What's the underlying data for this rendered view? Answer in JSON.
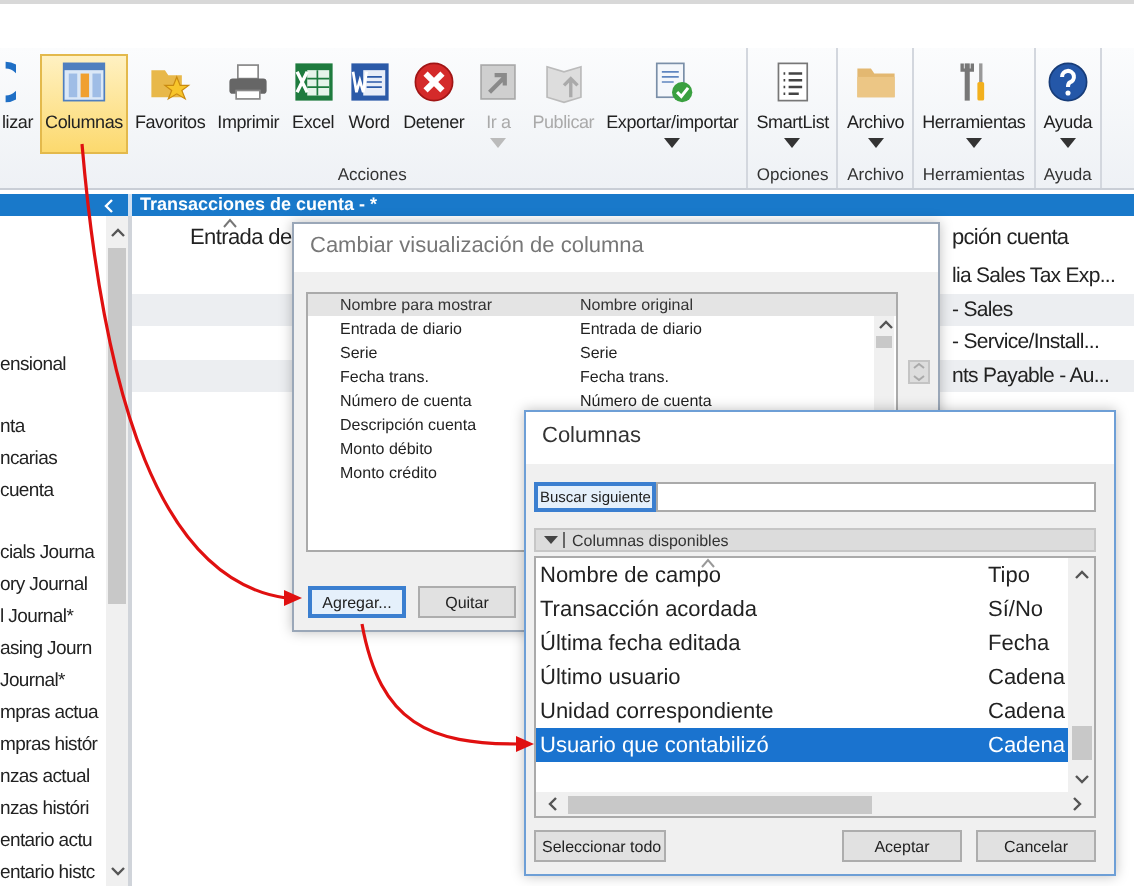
{
  "ribbon": {
    "groups": [
      {
        "label": "Acciones",
        "buttons": [
          {
            "kind": "refresh",
            "label": "lizar",
            "selected": false,
            "disabled": false,
            "dropdown": false
          },
          {
            "kind": "columns",
            "label": "Columnas",
            "selected": true,
            "disabled": false,
            "dropdown": false
          },
          {
            "kind": "favorites",
            "label": "Favoritos",
            "selected": false,
            "disabled": false,
            "dropdown": false
          },
          {
            "kind": "printer",
            "label": "Imprimir",
            "selected": false,
            "disabled": false,
            "dropdown": false
          },
          {
            "kind": "spreadsheet",
            "label": "Excel",
            "selected": false,
            "disabled": false,
            "dropdown": false
          },
          {
            "kind": "document",
            "label": "Word",
            "selected": false,
            "disabled": false,
            "dropdown": false
          },
          {
            "kind": "stop",
            "label": "Detener",
            "selected": false,
            "disabled": false,
            "dropdown": false
          },
          {
            "kind": "goto",
            "label": "Ir a",
            "selected": false,
            "disabled": true,
            "dropdown": true
          },
          {
            "kind": "publish",
            "label": "Publicar",
            "selected": false,
            "disabled": true,
            "dropdown": false
          },
          {
            "kind": "export",
            "label": "Exportar/importar",
            "selected": false,
            "disabled": false,
            "dropdown": true
          }
        ]
      },
      {
        "label": "Opciones",
        "buttons": [
          {
            "kind": "smartlist",
            "label": "SmartList",
            "selected": false,
            "disabled": false,
            "dropdown": true
          }
        ]
      },
      {
        "label": "Archivo",
        "buttons": [
          {
            "kind": "folder",
            "label": "Archivo",
            "selected": false,
            "disabled": false,
            "dropdown": true
          }
        ]
      },
      {
        "label": "Herramientas",
        "buttons": [
          {
            "kind": "tools",
            "label": "Herramientas",
            "selected": false,
            "disabled": false,
            "dropdown": true
          }
        ]
      },
      {
        "label": "Ayuda",
        "buttons": [
          {
            "kind": "help",
            "label": "Ayuda",
            "selected": false,
            "disabled": false,
            "dropdown": true
          }
        ]
      }
    ]
  },
  "document_tab": {
    "title": "Transacciones de cuenta - *"
  },
  "navigation_pane": {
    "sections": [
      [
        "ensional"
      ],
      [
        "nta",
        "ncarias",
        "cuenta"
      ],
      [
        "cials Journa",
        "ory Journal",
        "l Journal*",
        "asing Journ",
        "Journal*",
        "mpras actua",
        "mpras histór",
        "nzas actual",
        "nzas históri",
        "entario actu",
        "entario histc"
      ]
    ]
  },
  "grid": {
    "columns": [
      "Entrada de",
      "pción cuenta"
    ],
    "rows": [
      "lia Sales Tax Exp...",
      "- Sales",
      "- Service/Install...",
      "nts Payable - Au..."
    ]
  },
  "change_column_display_dialog": {
    "title": "Cambiar visualización de columna",
    "columns": [
      "Nombre para mostrar",
      "Nombre original"
    ],
    "rows": [
      [
        "Entrada de diario",
        "Entrada de diario"
      ],
      [
        "Serie",
        "Serie"
      ],
      [
        "Fecha trans.",
        "Fecha trans."
      ],
      [
        "Número de cuenta",
        "Número de cuenta"
      ],
      [
        "Descripción cuenta"
      ],
      [
        "Monto débito"
      ],
      [
        "Monto crédito"
      ]
    ],
    "buttons": [
      {
        "label": "Agregar...",
        "focused": true
      },
      {
        "label": "Quitar",
        "focused": false
      }
    ]
  },
  "columns_dialog": {
    "title": "Columnas",
    "search_button": "Buscar siguiente",
    "section": "Columnas disponibles",
    "columns": [
      "Nombre de campo",
      "Tipo"
    ],
    "rows": [
      {
        "name": "Transacción acordada",
        "type": "Sí/No",
        "selected": false
      },
      {
        "name": "Última fecha editada",
        "type": "Fecha",
        "selected": false
      },
      {
        "name": "Último usuario",
        "type": "Cadena",
        "selected": false
      },
      {
        "name": "Unidad correspondiente",
        "type": "Cadena",
        "selected": false
      },
      {
        "name": "Usuario que contabilizó",
        "type": "Cadena",
        "selected": true
      }
    ],
    "left_buttons": [
      "Seleccionar todo"
    ],
    "right_buttons": [
      "Aceptar",
      "Cancelar"
    ]
  }
}
